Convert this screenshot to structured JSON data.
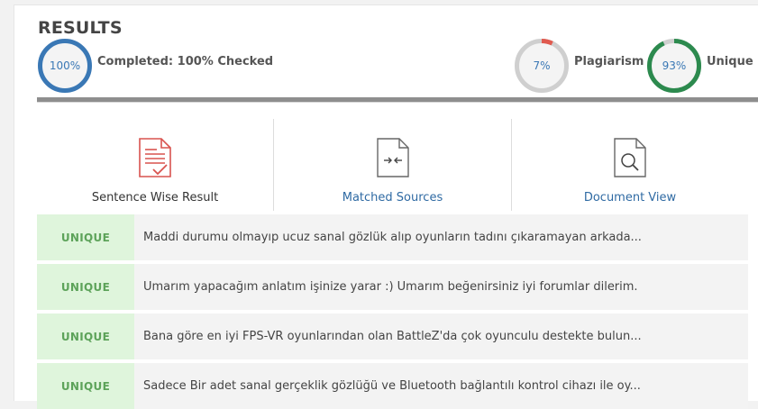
{
  "results": {
    "title": "RESULTS",
    "completed": {
      "value": "100%",
      "label": "Completed: 100% Checked",
      "fraction": 1.0,
      "color": "#3a78b5"
    },
    "plagiarism": {
      "value": "7%",
      "label": "Plagiarism",
      "fraction": 0.07,
      "color": "#e05a4f"
    },
    "unique": {
      "value": "93%",
      "label": "Unique",
      "fraction": 0.93,
      "color": "#2c8a4e"
    }
  },
  "tabs": [
    {
      "label": "Sentence Wise Result",
      "icon": "sentence-check-icon",
      "accent": "#d9534f"
    },
    {
      "label": "Matched Sources",
      "icon": "matched-sources-icon"
    },
    {
      "label": "Document View",
      "icon": "document-search-icon"
    }
  ],
  "rows": [
    {
      "badge": "UNIQUE",
      "text": "Maddi durumu olmayıp ucuz sanal gözlük alıp oyunların tadını çıkaramayan arkada..."
    },
    {
      "badge": "UNIQUE",
      "text": "Umarım yapacağım anlatım işinize yarar :) Umarım beğenirsiniz iyi forumlar dilerim."
    },
    {
      "badge": "UNIQUE",
      "text": "Bana göre en iyi FPS-VR oyunlarından olan BattleZ'da çok oyunculu destekte bulun..."
    },
    {
      "badge": "UNIQUE",
      "text": "Sadece Bir adet sanal gerçeklik gözlüğü ve Bluetooth bağlantılı kontrol cihazı ile oy..."
    }
  ]
}
